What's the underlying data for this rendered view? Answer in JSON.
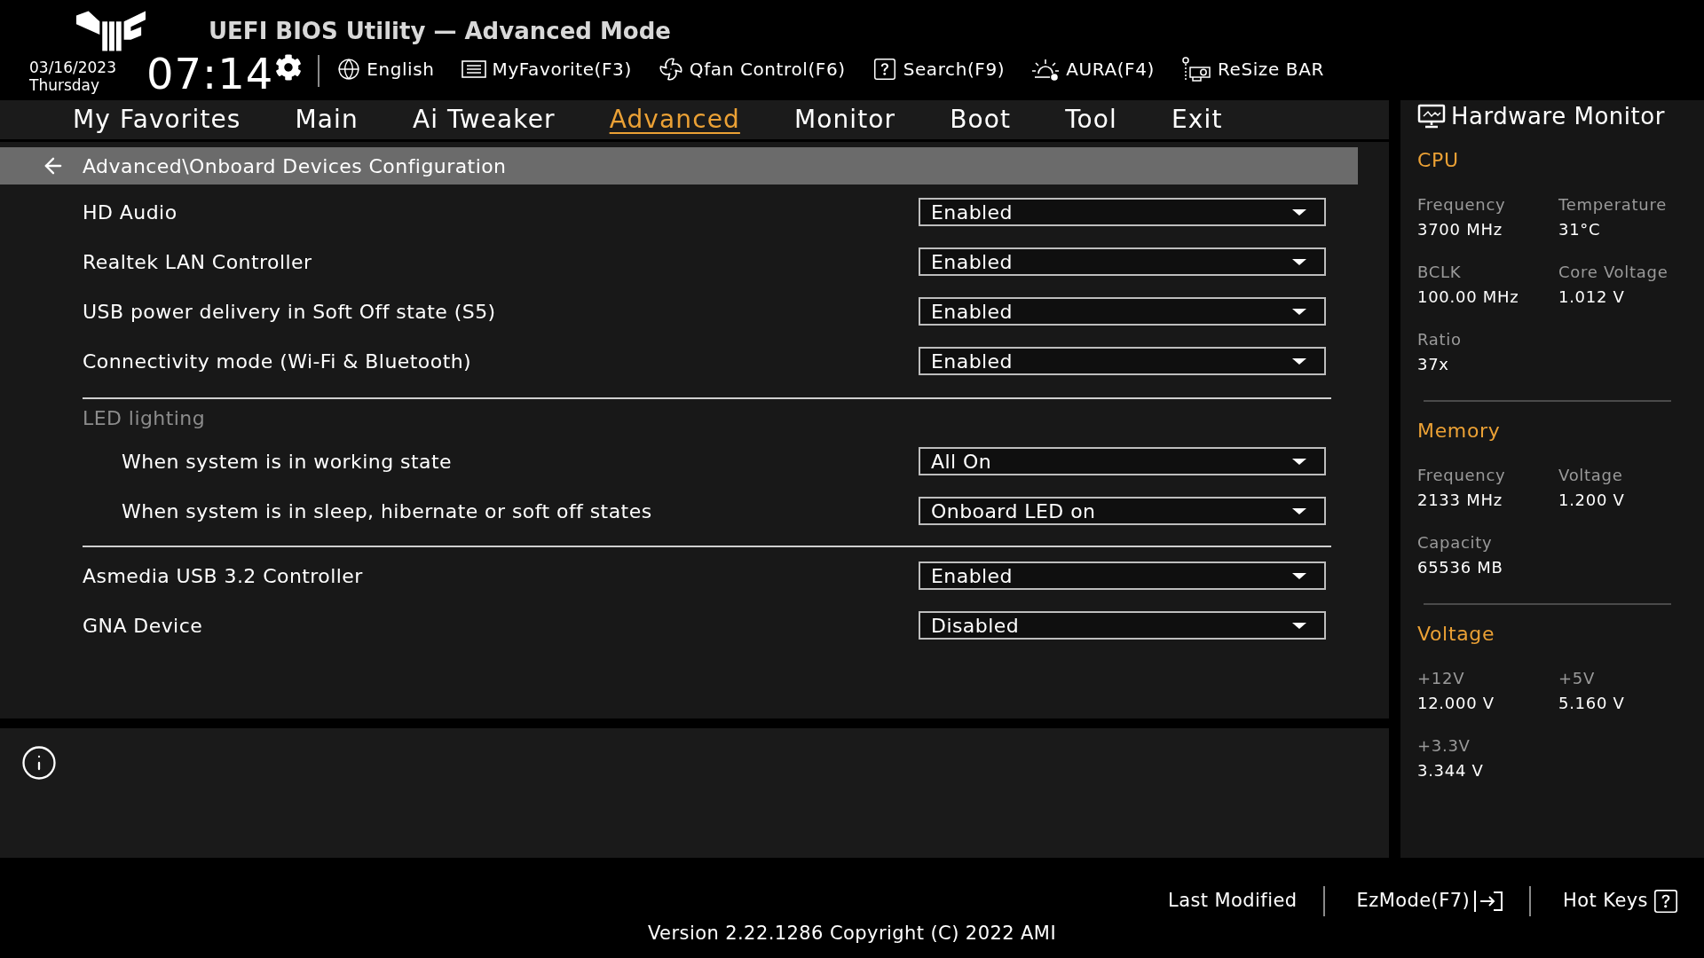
{
  "header": {
    "title": "UEFI BIOS Utility — Advanced Mode",
    "date": "03/16/2023",
    "day": "Thursday",
    "time": "07:14"
  },
  "toolbar": [
    {
      "kind": "globe",
      "label": "English"
    },
    {
      "kind": "favorites",
      "label": "MyFavorite(F3)"
    },
    {
      "kind": "fan",
      "label": "Qfan Control(F6)"
    },
    {
      "kind": "search",
      "label": "Search(F9)"
    },
    {
      "kind": "aura",
      "label": "AURA(F4)"
    },
    {
      "kind": "resize_bar",
      "label": "ReSize BAR"
    }
  ],
  "tabs": [
    {
      "label": "My Favorites",
      "selected": false
    },
    {
      "label": "Main",
      "selected": false
    },
    {
      "label": "Ai Tweaker",
      "selected": false
    },
    {
      "label": "Advanced",
      "selected": true
    },
    {
      "label": "Monitor",
      "selected": false
    },
    {
      "label": "Boot",
      "selected": false
    },
    {
      "label": "Tool",
      "selected": false
    },
    {
      "label": "Exit",
      "selected": false
    }
  ],
  "breadcrumb": "Advanced\\Onboard Devices Configuration",
  "settings": [
    {
      "kind": "option",
      "label": "HD Audio",
      "value": "Enabled"
    },
    {
      "kind": "option",
      "label": "Realtek LAN Controller",
      "value": "Enabled"
    },
    {
      "kind": "option",
      "label": "USB power delivery in Soft Off state (S5)",
      "value": "Enabled"
    },
    {
      "kind": "option",
      "label": "Connectivity mode (Wi-Fi & Bluetooth)",
      "value": "Enabled"
    },
    {
      "kind": "group",
      "label": "LED lighting",
      "children": [
        {
          "kind": "option",
          "label": "When system is in working state",
          "value": "All On"
        },
        {
          "kind": "option",
          "label": "When system is in sleep, hibernate or soft off states",
          "value": "Onboard LED on"
        }
      ]
    },
    {
      "kind": "option",
      "label": "Asmedia USB 3.2 Controller",
      "value": "Enabled"
    },
    {
      "kind": "option",
      "label": "GNA Device",
      "value": "Disabled"
    }
  ],
  "hardware_monitor": {
    "title": "Hardware Monitor",
    "sections": [
      {
        "title": "CPU",
        "items": [
          {
            "label": "Frequency",
            "value": "3700 MHz"
          },
          {
            "label": "Temperature",
            "value": "31°C"
          },
          {
            "label": "BCLK",
            "value": "100.00 MHz"
          },
          {
            "label": "Core Voltage",
            "value": "1.012 V"
          },
          {
            "label": "Ratio",
            "value": "37x"
          }
        ]
      },
      {
        "title": "Memory",
        "items": [
          {
            "label": "Frequency",
            "value": "2133 MHz"
          },
          {
            "label": "Voltage",
            "value": "1.200 V"
          },
          {
            "label": "Capacity",
            "value": "65536 MB"
          }
        ]
      },
      {
        "title": "Voltage",
        "items": [
          {
            "label": "+12V",
            "value": "12.000 V"
          },
          {
            "label": "+5V",
            "value": "5.160 V"
          },
          {
            "label": "+3.3V",
            "value": "3.344 V"
          }
        ]
      }
    ]
  },
  "footer": {
    "actions": [
      {
        "kind": "plain",
        "label": "Last Modified"
      },
      {
        "kind": "exit",
        "label": "EzMode(F7)"
      },
      {
        "kind": "help",
        "label": "Hot Keys"
      }
    ],
    "version": "Version 2.22.1286 Copyright (C) 2022 AMI"
  }
}
